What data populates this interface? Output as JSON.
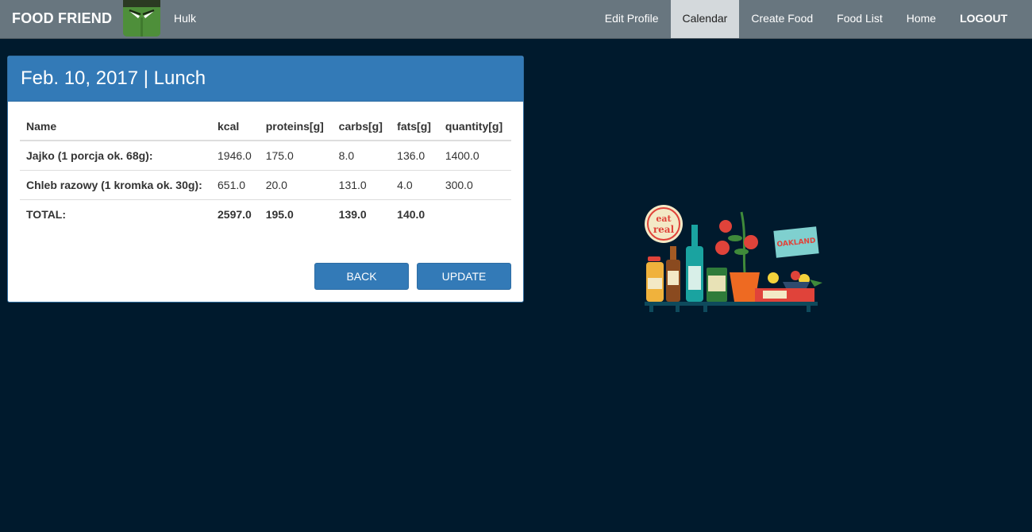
{
  "navbar": {
    "brand": "FOOD FRIEND",
    "user_name": "Hulk",
    "links": [
      {
        "label": "Edit Profile"
      },
      {
        "label": "Calendar",
        "active": true
      },
      {
        "label": "Create Food"
      },
      {
        "label": "Food List"
      },
      {
        "label": "Home"
      },
      {
        "label": "LOGOUT"
      }
    ]
  },
  "meal": {
    "heading": "Feb. 10, 2017 | Lunch",
    "columns": [
      "Name",
      "kcal",
      "proteins[g]",
      "carbs[g]",
      "fats[g]",
      "quantity[g]"
    ],
    "rows": [
      {
        "name": "Jajko (1 porcja ok. 68g):",
        "kcal": "1946.0",
        "proteins": "175.0",
        "carbs": "8.0",
        "fats": "136.0",
        "quantity": "1400.0"
      },
      {
        "name": "Chleb razowy (1 kromka ok. 30g):",
        "kcal": "651.0",
        "proteins": "20.0",
        "carbs": "131.0",
        "fats": "4.0",
        "quantity": "300.0"
      }
    ],
    "total": {
      "label": "TOTAL:",
      "kcal": "2597.0",
      "proteins": "195.0",
      "carbs": "139.0",
      "fats": "140.0"
    }
  },
  "buttons": {
    "back": "BACK",
    "update": "UPDATE"
  },
  "illustration": {
    "badge_text_1": "eat",
    "badge_text_2": "real",
    "sign_text": "OAKLAND"
  },
  "colors": {
    "background": "#001a2d",
    "navbar": "#68767f",
    "primary": "#337ab7"
  }
}
